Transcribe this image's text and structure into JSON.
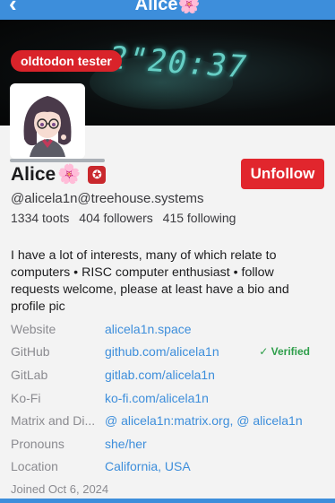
{
  "header": {
    "title": "Alice🌸"
  },
  "banner": {
    "clock_text": "2\"20:37",
    "tag": "oldtodon tester"
  },
  "profile": {
    "display_name": "Alice",
    "name_emoji": "🌸",
    "badge": "✪",
    "unfollow_label": "Unfollow",
    "handle": "@alicela1n@treehouse.systems",
    "toots": "1334 toots",
    "followers": "404 followers",
    "following": "415 following",
    "bio": "I have a lot of interests, many of which relate to computers • RISC computer enthusiast • follow requests welcome, please at least have a bio and profile pic"
  },
  "fields": [
    {
      "key": "Website",
      "value": "alicela1n.space"
    },
    {
      "key": "GitHub",
      "value": "github.com/alicela1n",
      "verified": "✓ Verified"
    },
    {
      "key": "GitLab",
      "value": "gitlab.com/alicela1n"
    },
    {
      "key": "Ko-Fi",
      "value": "ko-fi.com/alicela1n"
    },
    {
      "key": "Matrix and Di...",
      "value": "@ alicela1n:matrix.org, @ alicela1n"
    },
    {
      "key": "Pronouns",
      "value": "she/her"
    },
    {
      "key": "Location",
      "value": "California, USA"
    }
  ],
  "joined": "Joined Oct 6, 2024",
  "colors": {
    "accent": "#3d8edb",
    "danger": "#e1262d",
    "verified": "#2e9e4a"
  }
}
